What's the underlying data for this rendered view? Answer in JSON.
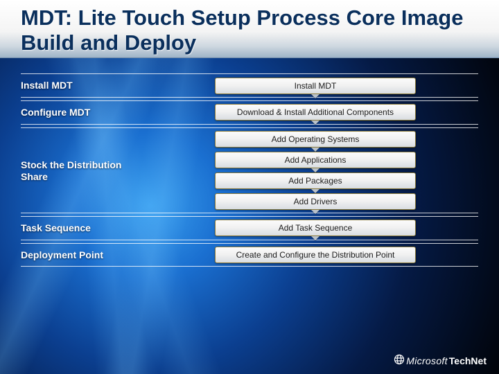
{
  "title": "MDT: Lite Touch Setup Process Core Image Build and Deploy",
  "rows": {
    "install": {
      "label": "Install MDT",
      "steps": [
        "Install MDT"
      ]
    },
    "configure": {
      "label": "Configure MDT",
      "steps": [
        "Download & Install Additional Components"
      ]
    },
    "stock": {
      "label": "Stock the Distribution Share",
      "steps": [
        "Add Operating Systems",
        "Add Applications",
        "Add Packages",
        "Add Drivers"
      ]
    },
    "task": {
      "label": "Task Sequence",
      "steps": [
        "Add Task Sequence"
      ]
    },
    "deploy": {
      "label": "Deployment Point",
      "steps": [
        "Create and Configure the Distribution Point"
      ]
    }
  },
  "footer": {
    "brand_left": "Microsoft",
    "brand_right": "TechNet"
  }
}
